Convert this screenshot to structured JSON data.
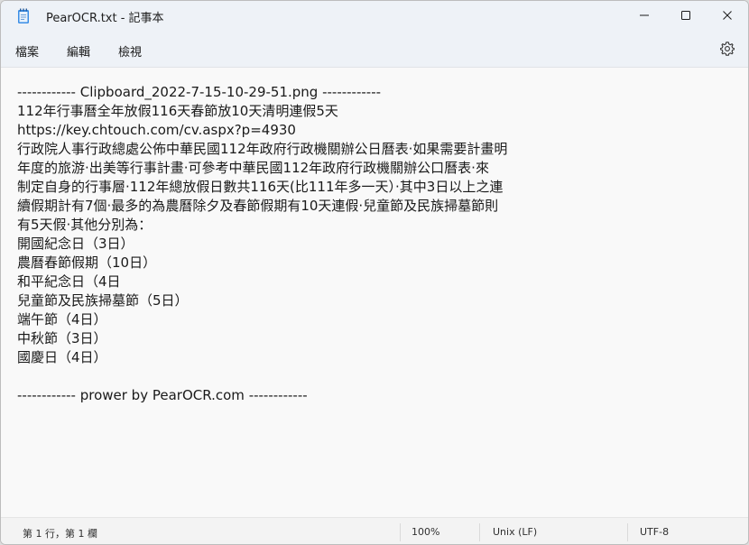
{
  "window": {
    "title": "PearOCR.txt - 記事本",
    "icon": "notepad-icon"
  },
  "menu": {
    "file": "檔案",
    "edit": "編輯",
    "view": "檢視",
    "settings_icon": "gear-icon"
  },
  "document": {
    "lines": [
      "------------ Clipboard_2022-7-15-10-29-51.png ------------",
      "112年行事曆全年放假116天春節放10天清明連假5天",
      "https://key.chtouch.com/cv.aspx?p=4930",
      "行政院人事行政總處公佈中華民國112年政府行政機關辦公日曆表‧如果需要計畫明",
      "年度的旅游‧出美等行事計畫‧可參考中華民國112年政府行政機關辦公口曆表‧來",
      "制定自身的行事層‧112年總放假日數共116天(比111年多一天）‧其中3日以上之連",
      "續假期計有7個‧最多的為農曆除夕及春節假期有10天連假‧兒童節及民族掃墓節則",
      "有5天假‧其他分別為：",
      "開國紀念日（3日）",
      "農曆春節假期（10日）",
      "和平紀念日（4日",
      "兒童節及民族掃墓節（5日）",
      "端午節（4日）",
      "中秋節（3日）",
      "國慶日（4日）",
      "",
      "------------ prower by PearOCR.com ------------"
    ]
  },
  "status": {
    "position": "第 1 行，第 1 欄",
    "zoom": "100%",
    "line_ending": "Unix (LF)",
    "encoding": "UTF-8"
  }
}
